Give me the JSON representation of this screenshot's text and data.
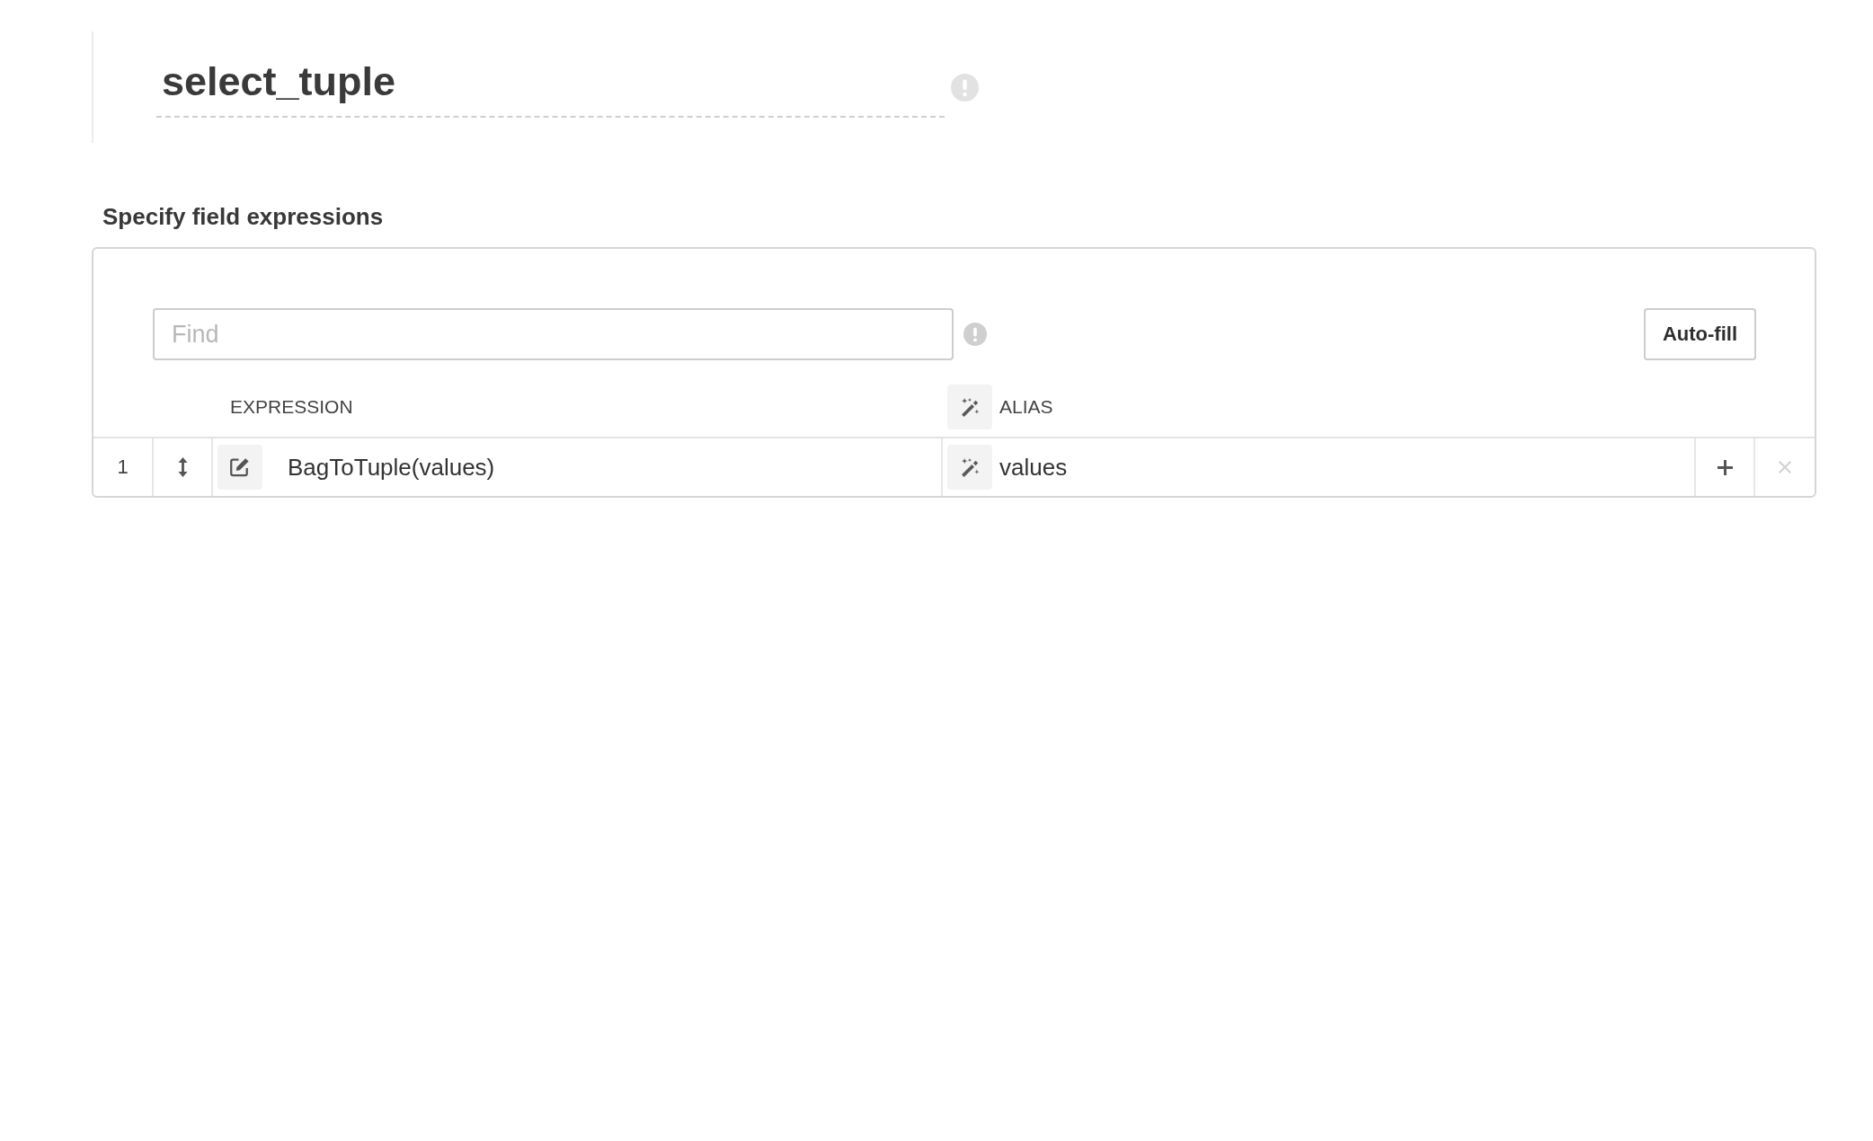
{
  "title_field": {
    "value": "select_tuple"
  },
  "expressions": {
    "heading": "Specify field expressions",
    "find": {
      "placeholder": "Find"
    },
    "autofill_button": {
      "label": "Auto-fill"
    },
    "columns": [
      {
        "label": "EXPRESSION"
      },
      {
        "label": "ALIAS"
      }
    ],
    "rows": [
      {
        "number": "1",
        "expression": "BagToTuple(values)",
        "alias": "values",
        "remove_disabled": true
      }
    ]
  }
}
